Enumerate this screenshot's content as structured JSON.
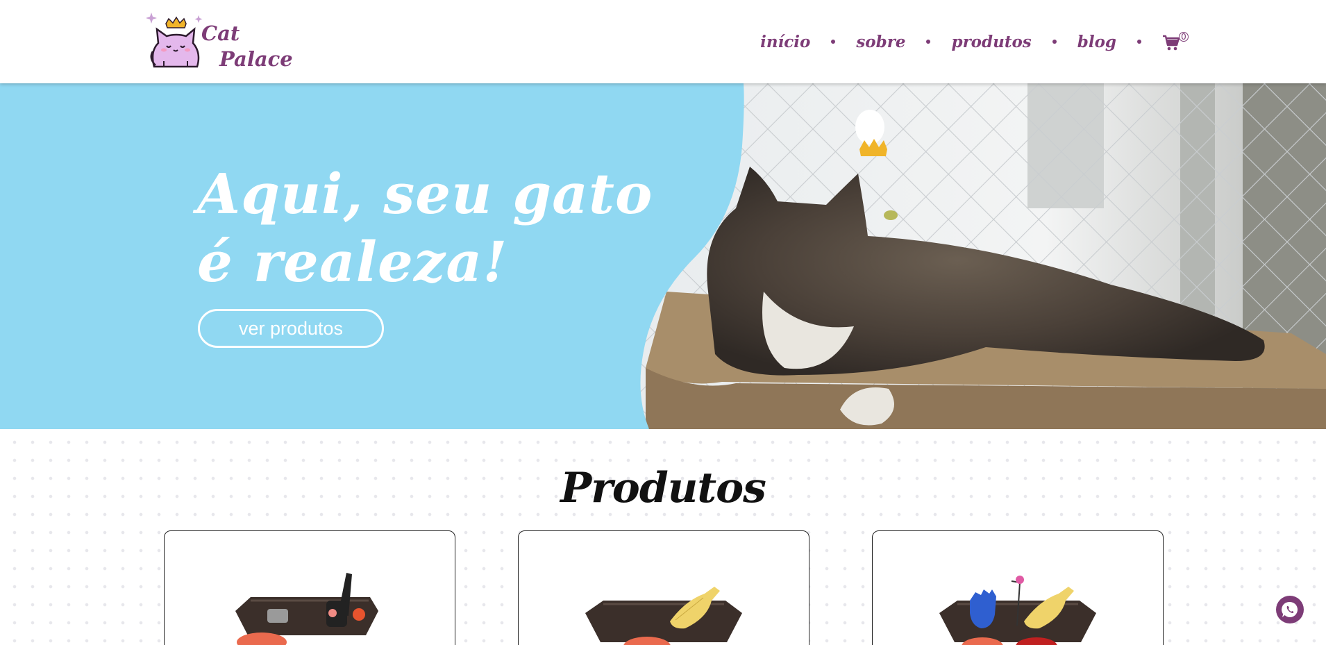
{
  "header": {
    "logo_line1": "Cat",
    "logo_line2": "Palace",
    "nav": {
      "home": "início",
      "about": "sobre",
      "products": "produtos",
      "blog": "blog"
    },
    "cart_count": "0",
    "cart_icon": "shopping-cart-icon"
  },
  "hero": {
    "title_line1": "Aqui, seu gato",
    "title_line2": "é realeza!",
    "cta_label": "ver produtos"
  },
  "products": {
    "title": "Produtos"
  },
  "floating": {
    "whatsapp_icon": "whatsapp-icon"
  },
  "colors": {
    "brand_purple": "#7d3c77",
    "hero_blue": "#90d8f2",
    "white": "#ffffff"
  }
}
